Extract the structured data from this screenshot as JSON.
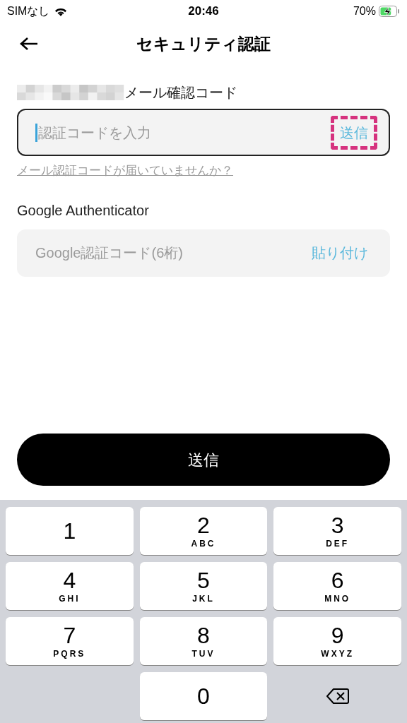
{
  "status_bar": {
    "carrier": "SIMなし",
    "time": "20:46",
    "battery": "70%",
    "charging": true
  },
  "header": {
    "title": "セキュリティ認証"
  },
  "email_section": {
    "label": "メール確認コード",
    "redacted": true,
    "field": {
      "placeholder": "認証コードを入力",
      "focused": true,
      "action": "送信",
      "action_highlighted": true
    },
    "help_link": "メール認証コードが届いていませんか？"
  },
  "google_section": {
    "label": "Google Authenticator",
    "field": {
      "placeholder": "Google認証コード(6桁)",
      "focused": false,
      "action": "貼り付け",
      "action_highlighted": false
    }
  },
  "submit_button": "送信",
  "keyboard": {
    "keys": [
      {
        "kind": "digit",
        "digit": "1"
      },
      {
        "kind": "digit",
        "digit": "2",
        "letters": "ABC"
      },
      {
        "kind": "digit",
        "digit": "3",
        "letters": "DEF"
      },
      {
        "kind": "digit",
        "digit": "4",
        "letters": "GHI"
      },
      {
        "kind": "digit",
        "digit": "5",
        "letters": "JKL"
      },
      {
        "kind": "digit",
        "digit": "6",
        "letters": "MNO"
      },
      {
        "kind": "digit",
        "digit": "7",
        "letters": "PQRS"
      },
      {
        "kind": "digit",
        "digit": "8",
        "letters": "TUV"
      },
      {
        "kind": "digit",
        "digit": "9",
        "letters": "WXYZ"
      },
      {
        "kind": "blank"
      },
      {
        "kind": "digit",
        "digit": "0"
      },
      {
        "kind": "backspace"
      }
    ]
  }
}
